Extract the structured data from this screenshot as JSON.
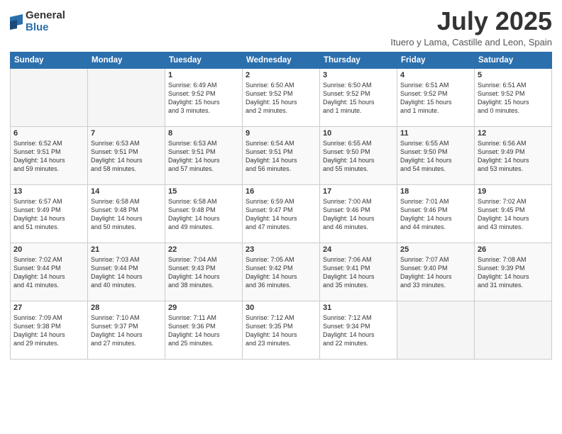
{
  "header": {
    "logo_general": "General",
    "logo_blue": "Blue",
    "month_title": "July 2025",
    "location": "Ituero y Lama, Castille and Leon, Spain"
  },
  "weekdays": [
    "Sunday",
    "Monday",
    "Tuesday",
    "Wednesday",
    "Thursday",
    "Friday",
    "Saturday"
  ],
  "weeks": [
    [
      {
        "day": "",
        "info": ""
      },
      {
        "day": "",
        "info": ""
      },
      {
        "day": "1",
        "info": "Sunrise: 6:49 AM\nSunset: 9:52 PM\nDaylight: 15 hours\nand 3 minutes."
      },
      {
        "day": "2",
        "info": "Sunrise: 6:50 AM\nSunset: 9:52 PM\nDaylight: 15 hours\nand 2 minutes."
      },
      {
        "day": "3",
        "info": "Sunrise: 6:50 AM\nSunset: 9:52 PM\nDaylight: 15 hours\nand 1 minute."
      },
      {
        "day": "4",
        "info": "Sunrise: 6:51 AM\nSunset: 9:52 PM\nDaylight: 15 hours\nand 1 minute."
      },
      {
        "day": "5",
        "info": "Sunrise: 6:51 AM\nSunset: 9:52 PM\nDaylight: 15 hours\nand 0 minutes."
      }
    ],
    [
      {
        "day": "6",
        "info": "Sunrise: 6:52 AM\nSunset: 9:51 PM\nDaylight: 14 hours\nand 59 minutes."
      },
      {
        "day": "7",
        "info": "Sunrise: 6:53 AM\nSunset: 9:51 PM\nDaylight: 14 hours\nand 58 minutes."
      },
      {
        "day": "8",
        "info": "Sunrise: 6:53 AM\nSunset: 9:51 PM\nDaylight: 14 hours\nand 57 minutes."
      },
      {
        "day": "9",
        "info": "Sunrise: 6:54 AM\nSunset: 9:51 PM\nDaylight: 14 hours\nand 56 minutes."
      },
      {
        "day": "10",
        "info": "Sunrise: 6:55 AM\nSunset: 9:50 PM\nDaylight: 14 hours\nand 55 minutes."
      },
      {
        "day": "11",
        "info": "Sunrise: 6:55 AM\nSunset: 9:50 PM\nDaylight: 14 hours\nand 54 minutes."
      },
      {
        "day": "12",
        "info": "Sunrise: 6:56 AM\nSunset: 9:49 PM\nDaylight: 14 hours\nand 53 minutes."
      }
    ],
    [
      {
        "day": "13",
        "info": "Sunrise: 6:57 AM\nSunset: 9:49 PM\nDaylight: 14 hours\nand 51 minutes."
      },
      {
        "day": "14",
        "info": "Sunrise: 6:58 AM\nSunset: 9:48 PM\nDaylight: 14 hours\nand 50 minutes."
      },
      {
        "day": "15",
        "info": "Sunrise: 6:58 AM\nSunset: 9:48 PM\nDaylight: 14 hours\nand 49 minutes."
      },
      {
        "day": "16",
        "info": "Sunrise: 6:59 AM\nSunset: 9:47 PM\nDaylight: 14 hours\nand 47 minutes."
      },
      {
        "day": "17",
        "info": "Sunrise: 7:00 AM\nSunset: 9:46 PM\nDaylight: 14 hours\nand 46 minutes."
      },
      {
        "day": "18",
        "info": "Sunrise: 7:01 AM\nSunset: 9:46 PM\nDaylight: 14 hours\nand 44 minutes."
      },
      {
        "day": "19",
        "info": "Sunrise: 7:02 AM\nSunset: 9:45 PM\nDaylight: 14 hours\nand 43 minutes."
      }
    ],
    [
      {
        "day": "20",
        "info": "Sunrise: 7:02 AM\nSunset: 9:44 PM\nDaylight: 14 hours\nand 41 minutes."
      },
      {
        "day": "21",
        "info": "Sunrise: 7:03 AM\nSunset: 9:44 PM\nDaylight: 14 hours\nand 40 minutes."
      },
      {
        "day": "22",
        "info": "Sunrise: 7:04 AM\nSunset: 9:43 PM\nDaylight: 14 hours\nand 38 minutes."
      },
      {
        "day": "23",
        "info": "Sunrise: 7:05 AM\nSunset: 9:42 PM\nDaylight: 14 hours\nand 36 minutes."
      },
      {
        "day": "24",
        "info": "Sunrise: 7:06 AM\nSunset: 9:41 PM\nDaylight: 14 hours\nand 35 minutes."
      },
      {
        "day": "25",
        "info": "Sunrise: 7:07 AM\nSunset: 9:40 PM\nDaylight: 14 hours\nand 33 minutes."
      },
      {
        "day": "26",
        "info": "Sunrise: 7:08 AM\nSunset: 9:39 PM\nDaylight: 14 hours\nand 31 minutes."
      }
    ],
    [
      {
        "day": "27",
        "info": "Sunrise: 7:09 AM\nSunset: 9:38 PM\nDaylight: 14 hours\nand 29 minutes."
      },
      {
        "day": "28",
        "info": "Sunrise: 7:10 AM\nSunset: 9:37 PM\nDaylight: 14 hours\nand 27 minutes."
      },
      {
        "day": "29",
        "info": "Sunrise: 7:11 AM\nSunset: 9:36 PM\nDaylight: 14 hours\nand 25 minutes."
      },
      {
        "day": "30",
        "info": "Sunrise: 7:12 AM\nSunset: 9:35 PM\nDaylight: 14 hours\nand 23 minutes."
      },
      {
        "day": "31",
        "info": "Sunrise: 7:12 AM\nSunset: 9:34 PM\nDaylight: 14 hours\nand 22 minutes."
      },
      {
        "day": "",
        "info": ""
      },
      {
        "day": "",
        "info": ""
      }
    ]
  ]
}
